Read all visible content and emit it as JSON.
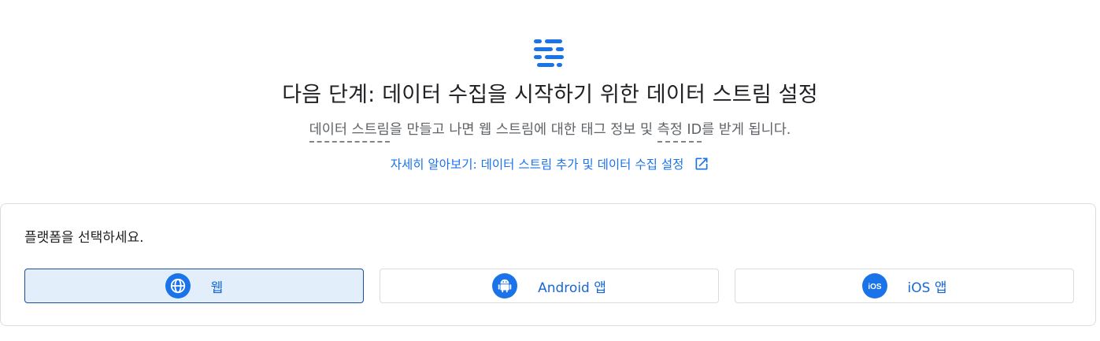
{
  "hero": {
    "title": "다음 단계: 데이터 수집을 시작하기 위한 데이터 스트림 설정",
    "subtitle_term1": "데이터 스트림",
    "subtitle_mid": "을 만들고 나면 웹 스트림에 대한 태그 정보 및 ",
    "subtitle_term2": "측정 ID",
    "subtitle_end": "를 받게 됩니다.",
    "learn_more_link": "자세히 알아보기: 데이터 스트림 추가 및 데이터 수집 설정",
    "icon": "data-stream-icon"
  },
  "platform_select": {
    "label": "플랫폼을 선택하세요.",
    "options": [
      {
        "label": "웹",
        "icon": "globe-icon",
        "selected": true
      },
      {
        "label": "Android 앱",
        "icon": "android-icon",
        "selected": false
      },
      {
        "label": "iOS 앱",
        "icon": "ios-icon",
        "selected": false
      }
    ]
  },
  "colors": {
    "accent": "#1a73e8",
    "selected_bg": "#e3eefb",
    "selected_border": "#1a4fa0"
  }
}
